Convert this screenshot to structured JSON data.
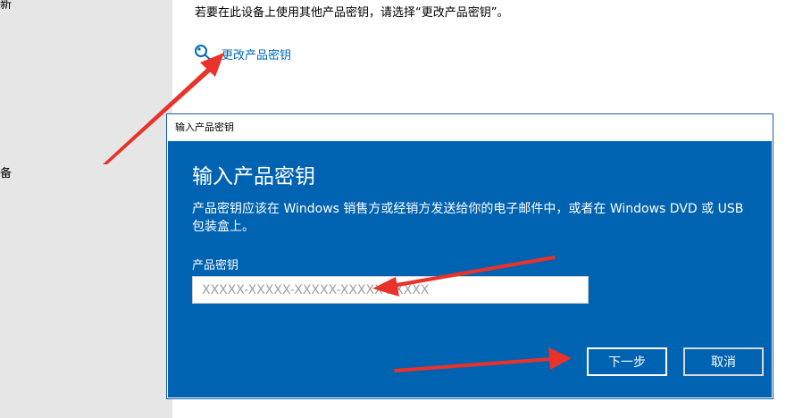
{
  "sidebar": {
    "fragments": [
      "新",
      "备"
    ]
  },
  "activation": {
    "info_text": "若要在此设备上使用其他产品密钥，请选择“更改产品密钥”。",
    "change_key_label": "更改产品密钥"
  },
  "dialog": {
    "title": "输入产品密钥",
    "heading": "输入产品密钥",
    "description": "产品密钥应该在 Windows 销售方或经销方发送给你的电子邮件中，或者在 Windows DVD 或 USB 包装盒上。",
    "field_label": "产品密钥",
    "input_placeholder": "XXXXX-XXXXX-XXXXX-XXXXX-XXXXX",
    "input_value": "",
    "next_label": "下一步",
    "cancel_label": "取消"
  },
  "colors": {
    "dialog_bg": "#0063b1",
    "link": "#0067b8",
    "annotation_arrow": "#e8322a"
  }
}
